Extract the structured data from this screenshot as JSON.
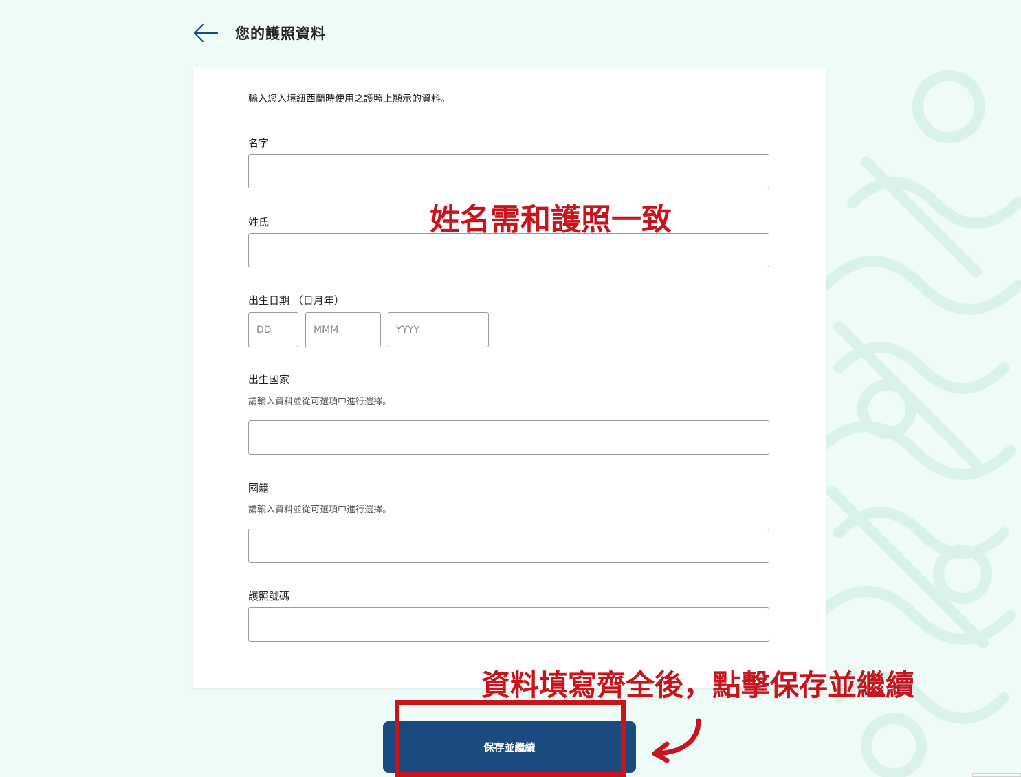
{
  "header": {
    "title": "您的護照資料",
    "back_icon": "arrow-left-icon"
  },
  "form": {
    "intro": "輸入您入境紐西蘭時使用之護照上顯示的資料。",
    "given_name": {
      "label": "名字",
      "value": ""
    },
    "family_name": {
      "label": "姓氏",
      "value": ""
    },
    "dob": {
      "label": "出生日期 （日月年）",
      "day_placeholder": "DD",
      "month_placeholder": "MMM",
      "year_placeholder": "YYYY"
    },
    "birth_country": {
      "label": "出生國家",
      "hint": "請輸入資料並從可選項中進行選擇。",
      "value": ""
    },
    "nationality": {
      "label": "國籍",
      "hint": "請輸入資料並從可選項中進行選擇。",
      "value": ""
    },
    "passport_number": {
      "label": "護照號碼",
      "value": ""
    },
    "save_label": "保存並繼續"
  },
  "annotations": {
    "name_note": "姓名需和護照一致",
    "save_note": "資料填寫齊全後，點擊保存並繼續",
    "color": "#c8141c"
  },
  "colors": {
    "background": "#effbf7",
    "primary_button": "#1b4a7e",
    "back_arrow": "#1b4a7e"
  }
}
